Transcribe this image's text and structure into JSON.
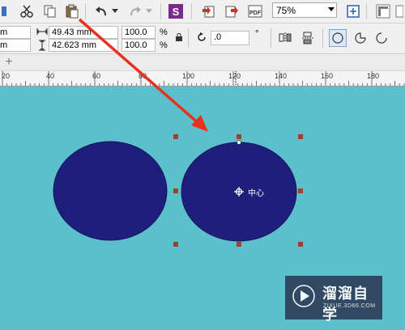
{
  "toolbar": {
    "zoom_value": "75%"
  },
  "property_bar": {
    "x_partial": "m",
    "y_partial": "m",
    "width_value": "49.43 mm",
    "height_value": "42.623 mm",
    "scale_w": "100.0",
    "scale_h": "100.0",
    "percent_w": "%",
    "percent_h": "%",
    "rotation_value": ".0",
    "degree_symbol": "°"
  },
  "tab_bar": {
    "add_label": "+"
  },
  "ruler": {
    "labels": [
      "20",
      "40",
      "60",
      "80",
      "100",
      "120",
      "140",
      "160",
      "180"
    ]
  },
  "canvas": {
    "center_label": "中心"
  },
  "watermark": {
    "title": "溜溜自学",
    "url": "ZIXUE.3D66.COM"
  },
  "colors": {
    "canvas_bg": "#5bbfcc",
    "ellipse_fill": "#1e1f7d",
    "handle": "#a0402a",
    "arrow": "#e8321e"
  }
}
